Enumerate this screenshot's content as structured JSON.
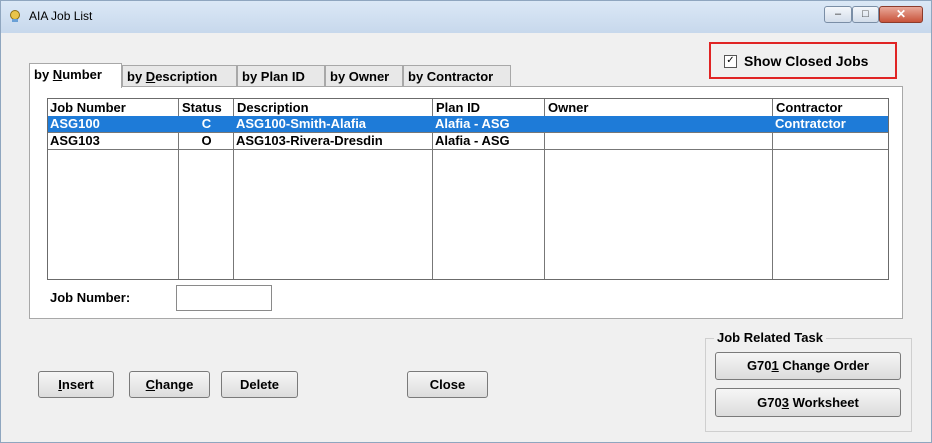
{
  "window": {
    "title": "AIA Job List",
    "controls": {
      "minimize": "–",
      "maximize": "□",
      "close": "✕"
    }
  },
  "show_closed": {
    "label": "Show Closed Jobs",
    "checked": true,
    "check_glyph": "✓"
  },
  "tabs": [
    {
      "pre": "by ",
      "accel": "N",
      "post": "umber",
      "active": true
    },
    {
      "pre": "by ",
      "accel": "D",
      "post": "escription",
      "active": false
    },
    {
      "pre": "by Plan ID",
      "accel": "",
      "post": "",
      "active": false
    },
    {
      "pre": "by Owner",
      "accel": "",
      "post": "",
      "active": false
    },
    {
      "pre": "by Contractor",
      "accel": "",
      "post": "",
      "active": false
    }
  ],
  "grid": {
    "headers": [
      "Job Number",
      "Status",
      "Description",
      "Plan ID",
      "Owner",
      "Contractor"
    ],
    "rows": [
      {
        "job": "ASG100",
        "status": "C",
        "description": "ASG100-Smith-Alafia",
        "plan": "Alafia - ASG",
        "owner": "",
        "contractor": "Contratctor",
        "selected": true
      },
      {
        "job": "ASG103",
        "status": "O",
        "description": "ASG103-Rivera-Dresdin",
        "plan": "Alafia - ASG",
        "owner": "",
        "contractor": "",
        "selected": false
      }
    ]
  },
  "job_number_field": {
    "label": "Job Number:",
    "value": ""
  },
  "buttons": {
    "insert": {
      "accel": "I",
      "rest": "nsert"
    },
    "change": {
      "accel": "C",
      "rest": "hange"
    },
    "delete": "Delete",
    "close": "Close"
  },
  "related": {
    "label": "Job Related Task",
    "g701": {
      "pre": "G70",
      "accel": "1",
      "post": " Change Order"
    },
    "g703": {
      "pre": "G70",
      "accel": "3",
      "post": " Worksheet"
    }
  },
  "colors": {
    "selection": "#1e7bd8",
    "highlight_border": "#e02424"
  }
}
